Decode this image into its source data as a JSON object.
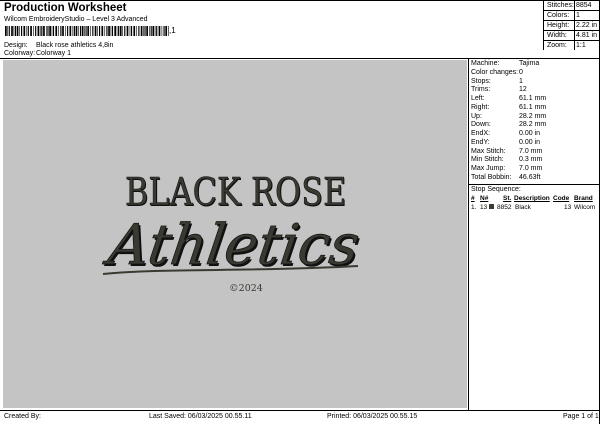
{
  "header": {
    "title": "Production Worksheet",
    "software": "Wilcom EmbroideryStudio – Level 3 Advanced",
    "barcode_suffix": ",1"
  },
  "info": {
    "design_label": "Design:",
    "design_value": "Black rose athletics 4,8in",
    "colorway_label": "Colorway:",
    "colorway_value": "Colorway 1"
  },
  "stats": [
    {
      "label": "Stitches:",
      "value": "8854"
    },
    {
      "label": "Colors:",
      "value": "1"
    },
    {
      "label": "Height:",
      "value": "2.22 in"
    },
    {
      "label": "Width:",
      "value": "4.81 in"
    },
    {
      "label": "Zoom:",
      "value": "1:1"
    }
  ],
  "design": {
    "line1": "BLACK ROSE",
    "line2": "Athletics",
    "copyright": "©2024",
    "thread_color": "#3a3a32",
    "canvas_color": "#c4c4c4"
  },
  "machine": [
    {
      "label": "Machine:",
      "value": "Tajima"
    },
    {
      "label": "Color changes:",
      "value": "0"
    },
    {
      "label": "Stops:",
      "value": "1"
    },
    {
      "label": "Trims:",
      "value": "12"
    },
    {
      "label": "Left:",
      "value": "61.1 mm"
    },
    {
      "label": "Right:",
      "value": "61.1 mm"
    },
    {
      "label": "Up:",
      "value": "28.2 mm"
    },
    {
      "label": "Down:",
      "value": "28.2 mm"
    },
    {
      "label": "EndX:",
      "value": "0.00 in"
    },
    {
      "label": "EndY:",
      "value": "0.00 in"
    },
    {
      "label": "Max Stitch:",
      "value": "7.0 mm"
    },
    {
      "label": "Min Stitch:",
      "value": "0.3 mm"
    },
    {
      "label": "Max Jump:",
      "value": "7.0 mm"
    },
    {
      "label": "Total Bobbin:",
      "value": "46.63ft"
    }
  ],
  "stop_sequence": {
    "title": "Stop Sequence:",
    "columns": {
      "hash": "#",
      "n": "N#",
      "st": "St.",
      "description": "Description",
      "code": "Code",
      "brand": "Brand"
    },
    "rows": [
      {
        "hash": "1.",
        "n": "13",
        "st": "8852",
        "description": "Black",
        "code": "13",
        "brand": "Wilcom",
        "color": "#3a3a32"
      }
    ]
  },
  "footer": {
    "created_by": "Created By:",
    "last_saved": "Last Saved: 06/03/2025 00.55.11",
    "printed": "Printed: 06/03/2025 00.55.15",
    "page": "Page 1 of 1"
  }
}
